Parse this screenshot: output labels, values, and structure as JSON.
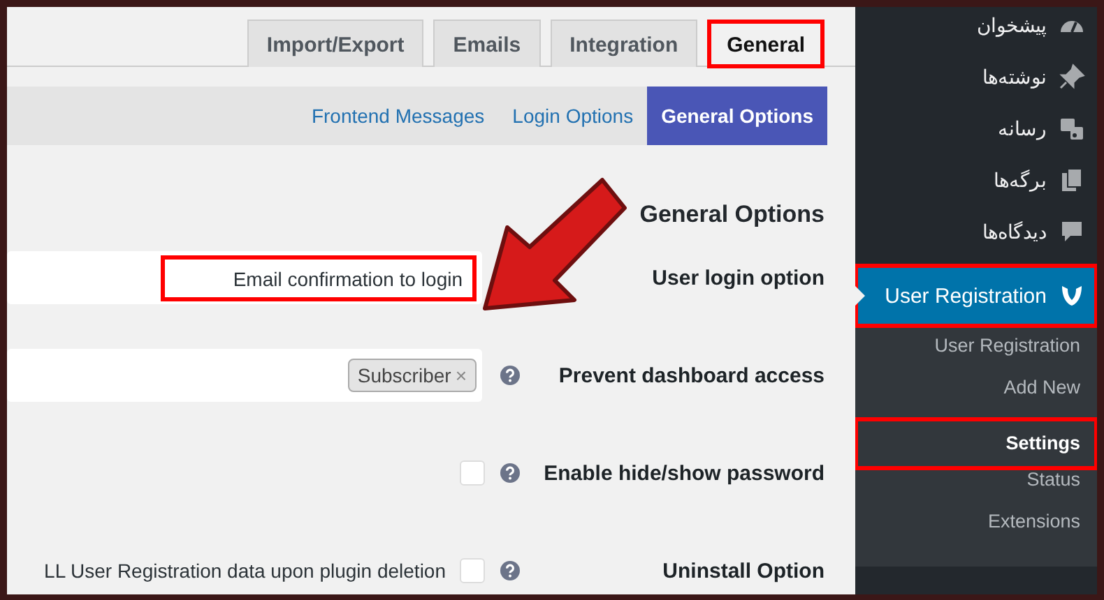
{
  "tabs": [
    {
      "label": "Import/Export",
      "selected": false,
      "highlighted": false
    },
    {
      "label": "Emails",
      "selected": false,
      "highlighted": false
    },
    {
      "label": "Integration",
      "selected": false,
      "highlighted": false
    },
    {
      "label": "General",
      "selected": true,
      "highlighted": true
    }
  ],
  "subnav": [
    {
      "label": "Frontend Messages",
      "selected": false
    },
    {
      "label": "Login Options",
      "selected": false
    },
    {
      "label": "General Options",
      "selected": true
    }
  ],
  "section_title": "General Options",
  "callout_arrow": true,
  "options": [
    {
      "kind": "select",
      "label": "User login option",
      "value": "Email confirmation to login",
      "help": false,
      "highlighted": true
    },
    {
      "kind": "tags",
      "label": "Prevent dashboard access",
      "tags": [
        {
          "text": "Subscriber",
          "remove": "×"
        }
      ],
      "help": true,
      "highlighted": false
    },
    {
      "kind": "checkbox",
      "label": "Enable hide/show password",
      "checked": false,
      "help": true,
      "highlighted": false
    },
    {
      "kind": "checkbox",
      "label": "Uninstall Option",
      "description": "LL User Registration data upon plugin deletion",
      "checked": false,
      "help": true,
      "highlighted": false
    }
  ],
  "sidebar": {
    "items": [
      {
        "label": "پیشخوان",
        "selected": false,
        "highlighted": false
      },
      {
        "label": "نوشته‌ها",
        "selected": false,
        "highlighted": false
      },
      {
        "label": "رسانه",
        "selected": false,
        "highlighted": false
      },
      {
        "label": "برگه‌ها",
        "selected": false,
        "highlighted": false
      },
      {
        "label": "دیدگاه‌ها",
        "selected": false,
        "highlighted": false
      },
      {
        "label": "User Registration",
        "selected": true,
        "highlighted": true,
        "children": [
          {
            "label": "User Registration",
            "selected": false,
            "highlighted": false
          },
          {
            "label": "Add New",
            "selected": false,
            "highlighted": false
          },
          {
            "label": "Settings",
            "selected": true,
            "highlighted": true
          },
          {
            "label": "Status",
            "selected": false,
            "highlighted": false
          },
          {
            "label": "Extensions",
            "selected": false,
            "highlighted": false
          }
        ]
      }
    ]
  }
}
